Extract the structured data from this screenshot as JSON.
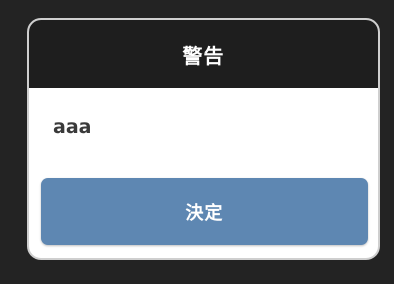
{
  "dialog": {
    "title": "警告",
    "message": "aaa",
    "confirm_label": "決定"
  },
  "colors": {
    "background": "#232323",
    "header": "#1e1e1e",
    "button": "#5e87b2",
    "dialog_body": "#ffffff"
  }
}
